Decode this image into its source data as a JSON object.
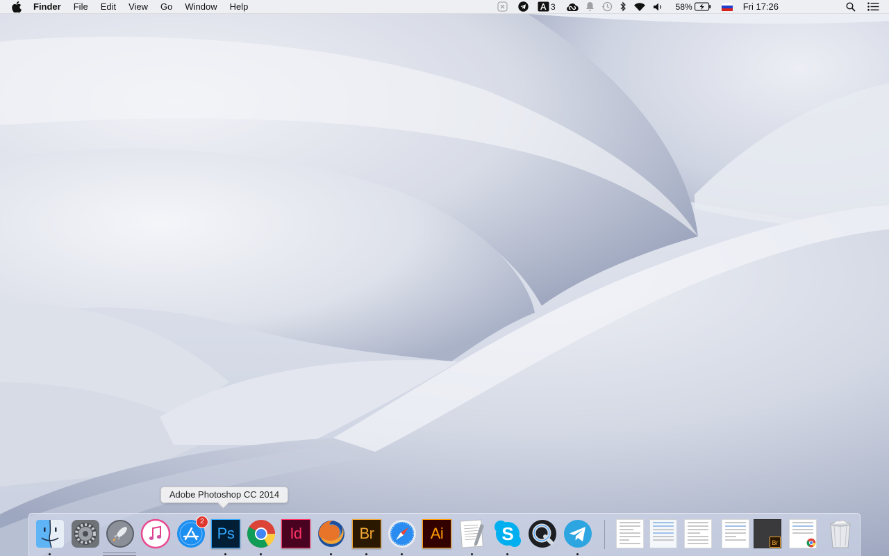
{
  "menubar": {
    "app_name": "Finder",
    "menus": [
      "File",
      "Edit",
      "View",
      "Go",
      "Window",
      "Help"
    ],
    "adobe_count": "3",
    "battery_percent": "58%",
    "clock": "Fri 17:26"
  },
  "status_icons": [
    "dnd-x-icon",
    "telegram-icon",
    "adobe-ai-icon",
    "creative-cloud-icon",
    "notification-bell-icon",
    "time-machine-icon",
    "bluetooth-icon",
    "wifi-icon",
    "volume-icon",
    "battery-icon",
    "flag-icon",
    "spotlight-icon",
    "notification-center-icon"
  ],
  "tooltip": {
    "text": "Adobe Photoshop CC 2014"
  },
  "dock": {
    "apps": [
      {
        "name": "Finder",
        "running": true
      },
      {
        "name": "System Preferences",
        "running": false
      },
      {
        "name": "Launchpad",
        "running": false
      },
      {
        "name": "iTunes",
        "running": false
      },
      {
        "name": "App Store",
        "running": false,
        "badge": "2"
      },
      {
        "name": "Adobe Photoshop CC 2014",
        "running": true,
        "label": "Ps"
      },
      {
        "name": "Google Chrome",
        "running": true
      },
      {
        "name": "Adobe InDesign",
        "running": false,
        "label": "Id"
      },
      {
        "name": "Firefox",
        "running": true
      },
      {
        "name": "Adobe Bridge",
        "running": true,
        "label": "Br"
      },
      {
        "name": "Safari",
        "running": true
      },
      {
        "name": "Adobe Illustrator",
        "running": false,
        "label": "Ai"
      },
      {
        "name": "TextEdit",
        "running": true
      },
      {
        "name": "Skype",
        "running": true
      },
      {
        "name": "QuickTime Player",
        "running": false
      },
      {
        "name": "Telegram",
        "running": true
      }
    ],
    "minimized_windows": 6,
    "trash": "Trash"
  },
  "colors": {
    "photoshop": "#31a8ff",
    "photoshop_bg": "#001e36",
    "indesign": "#ff3366",
    "indesign_bg": "#49021f",
    "bridge": "#f2a633",
    "bridge_bg": "#2b1800",
    "illustrator": "#ff9a00",
    "illustrator_bg": "#330000",
    "badge": "#e0362c"
  }
}
